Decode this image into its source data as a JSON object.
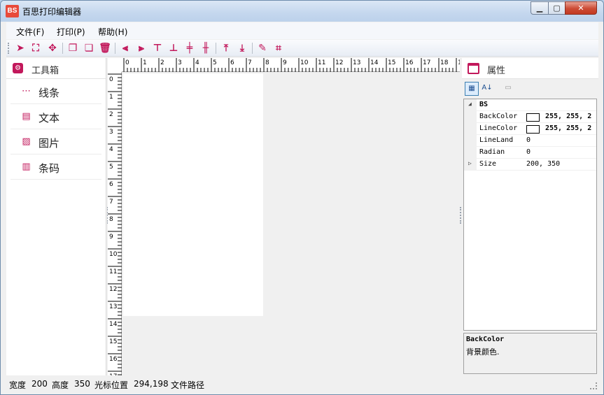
{
  "window": {
    "title": "百思打印编辑器",
    "app_icon": "BS"
  },
  "menu": [
    {
      "label": "文件(F)"
    },
    {
      "label": "打印(P)"
    },
    {
      "label": "帮助(H)"
    }
  ],
  "toolbar": [
    {
      "name": "pointer-icon",
      "glyph": "➤"
    },
    {
      "name": "select-rect-icon",
      "glyph": "⛶"
    },
    {
      "name": "move-icon",
      "glyph": "✥"
    },
    {
      "name": "copy-icon",
      "glyph": "❐"
    },
    {
      "name": "paste-icon",
      "glyph": "❏"
    },
    {
      "name": "delete-icon",
      "glyph": "🗑"
    },
    {
      "name": "align-left-icon",
      "glyph": "⫷"
    },
    {
      "name": "align-right-icon",
      "glyph": "⫸"
    },
    {
      "name": "align-top-icon",
      "glyph": "⊤"
    },
    {
      "name": "align-bottom-icon",
      "glyph": "⊥"
    },
    {
      "name": "align-center-h-icon",
      "glyph": "╪"
    },
    {
      "name": "align-center-v-icon",
      "glyph": "╫"
    },
    {
      "name": "bring-front-icon",
      "glyph": "⤒"
    },
    {
      "name": "send-back-icon",
      "glyph": "⤓"
    },
    {
      "name": "edit-icon",
      "glyph": "✎"
    },
    {
      "name": "crop-icon",
      "glyph": "⌗"
    }
  ],
  "toolbox": {
    "title": "工具箱",
    "items": [
      {
        "label": "线条",
        "icon": "line-icon",
        "glyph": "⋯"
      },
      {
        "label": "文本",
        "icon": "text-icon",
        "glyph": "▤"
      },
      {
        "label": "图片",
        "icon": "image-icon",
        "glyph": "▨"
      },
      {
        "label": "条码",
        "icon": "barcode-icon",
        "glyph": "▥"
      }
    ]
  },
  "ruler": {
    "top": [
      "0",
      "1",
      "2",
      "3",
      "4",
      "5",
      "6",
      "7",
      "8",
      "9",
      "10",
      "11",
      "12",
      "13",
      "14",
      "15",
      "16",
      "17",
      "18",
      "1"
    ],
    "left": [
      "0",
      "1",
      "2",
      "3",
      "4",
      "5",
      "6",
      "7",
      "8",
      "9",
      "10",
      "11",
      "12",
      "13",
      "14",
      "15",
      "16",
      "17"
    ]
  },
  "properties": {
    "title": "属性",
    "category": "BS",
    "rows": [
      {
        "name": "BackColor",
        "value": "255, 255, 2",
        "swatch": "#ffffff"
      },
      {
        "name": "LineColor",
        "value": "255, 255, 2",
        "swatch": "#ffffff"
      },
      {
        "name": "LineLand",
        "value": "0"
      },
      {
        "name": "Radian",
        "value": "0"
      },
      {
        "name": "Size",
        "value": "200, 350",
        "expandable": true
      }
    ],
    "description": {
      "title": "BackColor",
      "text": "背景颜色."
    }
  },
  "status": {
    "width_label": "宽度",
    "width_value": "200",
    "height_label": "高度",
    "height_value": "350",
    "cursor_label": "光标位置",
    "cursor_value": "294,198",
    "path_label": "文件路径"
  },
  "colors": {
    "accent": "#c2185b"
  }
}
